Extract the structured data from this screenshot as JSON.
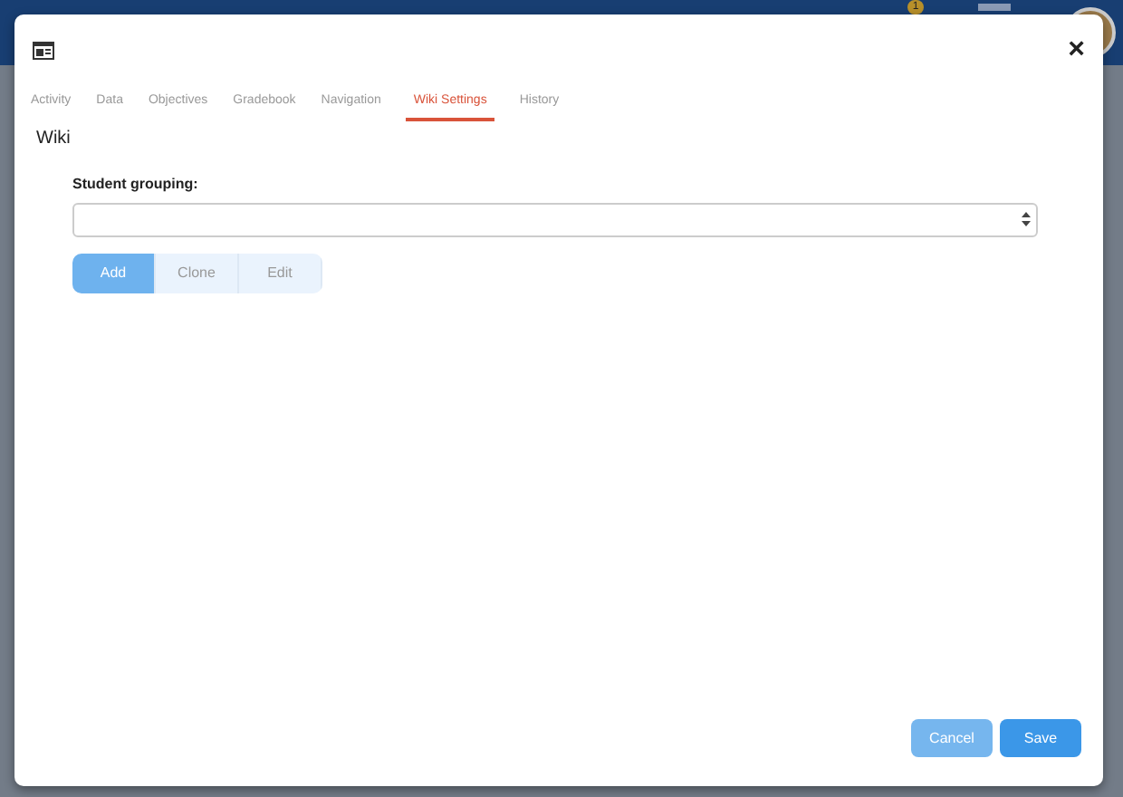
{
  "app_bar": {
    "notification_count": "1"
  },
  "dialog": {
    "close": "×",
    "tabs": [
      {
        "label": "Activity",
        "selected": false
      },
      {
        "label": "Data",
        "selected": false
      },
      {
        "label": "Objectives",
        "selected": false
      },
      {
        "label": "Gradebook",
        "selected": false
      },
      {
        "label": "Navigation",
        "selected": false
      },
      {
        "label": "Wiki Settings",
        "selected": true
      },
      {
        "label": "History",
        "selected": false
      }
    ],
    "section_title": "Wiki",
    "field_label": "Student grouping:",
    "segments": [
      {
        "label": "Add",
        "selected": true
      },
      {
        "label": "Clone",
        "selected": false
      },
      {
        "label": "Edit",
        "selected": false
      }
    ],
    "footer_buttons": [
      {
        "label": "Cancel",
        "kind": "secondary"
      },
      {
        "label": "Save",
        "kind": "primary"
      }
    ]
  }
}
